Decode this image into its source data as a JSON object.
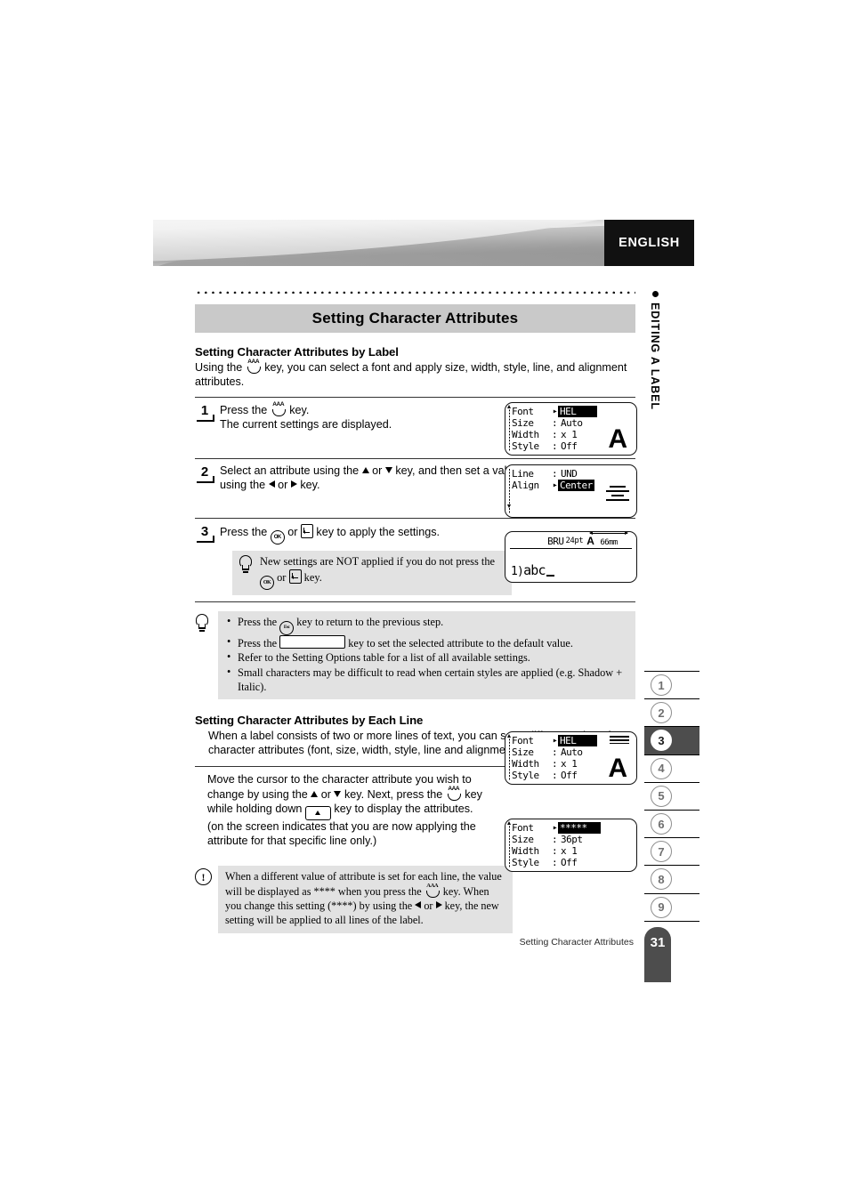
{
  "banner": {
    "language_tab": "ENGLISH"
  },
  "chapter_label": "EDITING A LABEL",
  "heading": "Setting Character Attributes",
  "section_by_label": {
    "title": "Setting Character Attributes by Label",
    "intro_a": "Using the",
    "intro_b": "key, you can select a font and apply size, width, style, line, and alignment attributes."
  },
  "steps": [
    {
      "number": "1",
      "text_a": "Press the",
      "text_b": "key.",
      "text_c": "The current settings are displayed."
    },
    {
      "number": "2",
      "text_a": "Select an attribute using the",
      "text_b": "or",
      "text_c": "key, and then set a value for that attribute using the",
      "text_d": "or",
      "text_e": "key."
    },
    {
      "number": "3",
      "text_a": "Press the",
      "text_b": "or",
      "text_c": "key to apply the settings."
    }
  ],
  "step3_tip": {
    "text_a": "New settings are NOT applied if you do not press the",
    "text_b": "or",
    "text_c": "key."
  },
  "tip_bullets": [
    {
      "a": "Press the",
      "b": "key to return to the previous step."
    },
    {
      "a": "Press the",
      "b": "key to set the selected attribute to the default value."
    },
    {
      "a": "Refer to the Setting Options table for a list of all available settings.",
      "b": ""
    },
    {
      "a": "Small characters may be difficult to read when certain styles are applied (e.g. Shadow + Italic).",
      "b": ""
    }
  ],
  "section_by_line": {
    "title": "Setting Character Attributes by Each Line",
    "intro": "When a label consists of two or more lines of text, you can set a different value of character attributes (font, size, width, style, line and alignment) for each line.",
    "body_a": "Move the cursor to the character attribute you wish to change by using the",
    "body_b": "or",
    "body_c": "key. Next, press the",
    "body_d": "key while holding down",
    "body_e": "key to display the attributes. (on the screen indicates that you are now applying the attribute for that specific line only.)"
  },
  "warning_note": {
    "text_a": "When a different value of attribute is set for each line, the value will be displayed as **** when you press the",
    "text_b": "key. When you change this setting (****) by using the",
    "text_c": "or",
    "text_d": "key, the new setting will be applied to all lines of the label.",
    "icon": "exclamation-icon"
  },
  "lcd_screens": {
    "step1": {
      "rows": [
        {
          "label": "Font",
          "sep": ":",
          "caret": "▸",
          "value": "HEL",
          "highlight": true
        },
        {
          "label": "Size",
          "sep": ":",
          "caret": "",
          "value": "Auto",
          "highlight": false
        },
        {
          "label": "Width",
          "sep": ":",
          "caret": "",
          "value": "x 1",
          "highlight": false
        },
        {
          "label": "Style",
          "sep": ":",
          "caret": "",
          "value": "Off",
          "highlight": false
        }
      ],
      "preview_glyph": "A"
    },
    "step2": {
      "rows": [
        {
          "label": "Line",
          "sep": ":",
          "caret": "",
          "value": "UND",
          "highlight": false
        },
        {
          "label": "Align",
          "sep": ":",
          "caret": "▸",
          "value": "Center",
          "highlight": true
        }
      ],
      "preview_glyph": "center-align-icon"
    },
    "step3": {
      "font_tag": "BRU",
      "size_tag": "24pt",
      "style_tag": "A",
      "length": "66mm",
      "label_text": "abc",
      "line_marker": "1"
    },
    "each_line": {
      "rows": [
        {
          "label": "Font",
          "sep": ":",
          "caret": "▸",
          "value": "HEL",
          "highlight": true
        },
        {
          "label": "Size",
          "sep": ":",
          "caret": "",
          "value": "Auto",
          "highlight": false
        },
        {
          "label": "Width",
          "sep": ":",
          "caret": "",
          "value": "x 1",
          "highlight": false
        },
        {
          "label": "Style",
          "sep": ":",
          "caret": "",
          "value": "Off",
          "highlight": false
        }
      ],
      "preview_glyph": "A",
      "line_indicator": "three-lines-icon"
    },
    "warning": {
      "rows": [
        {
          "label": "Font",
          "sep": ":",
          "caret": "▸",
          "value": "*****",
          "highlight": true
        },
        {
          "label": "Size",
          "sep": ":",
          "caret": "",
          "value": "36pt",
          "highlight": false
        },
        {
          "label": "Width",
          "sep": ":",
          "caret": "",
          "value": "x 1",
          "highlight": false
        },
        {
          "label": "Style",
          "sep": ":",
          "caret": "",
          "value": "Off",
          "highlight": false
        }
      ]
    }
  },
  "rail_tabs": [
    "1",
    "2",
    "3",
    "4",
    "5",
    "6",
    "7",
    "8",
    "9"
  ],
  "rail_active": "3",
  "footer": {
    "title": "Setting Character Attributes",
    "page": "31"
  },
  "colors": {
    "heading_bg": "#c9c9c9",
    "tip_bg": "#e2e2e2",
    "accent_dark": "#4d4d4d",
    "tab_black": "#111111"
  }
}
